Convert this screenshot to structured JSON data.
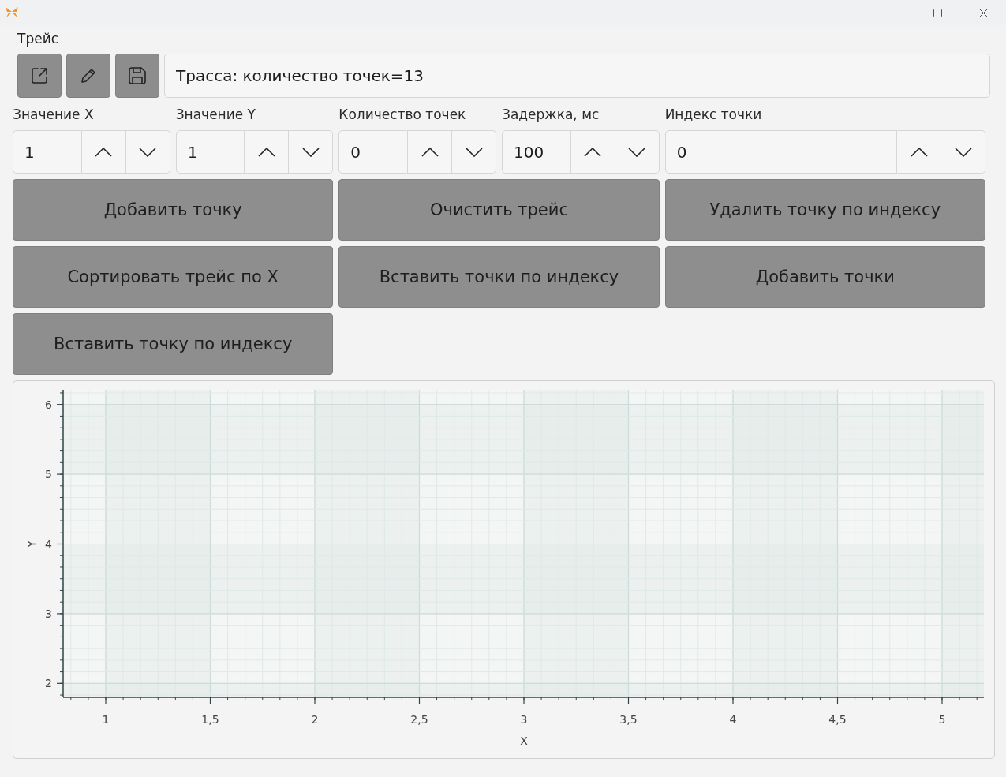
{
  "trace": {
    "label": "Трейс",
    "info": "Трасса: количество точек=13"
  },
  "spinners": [
    {
      "label": "Значение X",
      "value": "1"
    },
    {
      "label": "Значение Y",
      "value": "1"
    },
    {
      "label": "Количество точек",
      "value": "0"
    },
    {
      "label": "Задержка, мс",
      "value": "100"
    },
    {
      "label": "Индекс точки",
      "value": "0"
    }
  ],
  "buttons": [
    "Добавить точку",
    "Очистить трейс",
    "Удалить точку по индексу",
    "Сортировать трейс по X",
    "Вставить точки по индексу",
    "Добавить точки",
    "Вставить точку по индексу"
  ],
  "chart": {
    "chart_data": {
      "type": "line",
      "xlabel": "X",
      "ylabel": "Y",
      "xlim": [
        0.8,
        5.2
      ],
      "ylim": [
        1.8,
        6.2
      ],
      "xticks": [
        {
          "value": 1,
          "label": "1"
        },
        {
          "value": 1.5,
          "label": "1,5"
        },
        {
          "value": 2,
          "label": "2"
        },
        {
          "value": 2.5,
          "label": "2,5"
        },
        {
          "value": 3,
          "label": "3"
        },
        {
          "value": 3.5,
          "label": "3,5"
        },
        {
          "value": 4,
          "label": "4"
        },
        {
          "value": 4.5,
          "label": "4,5"
        },
        {
          "value": 5,
          "label": "5"
        }
      ],
      "yticks": [
        2,
        3,
        4,
        5,
        6
      ],
      "grid": true
    }
  }
}
